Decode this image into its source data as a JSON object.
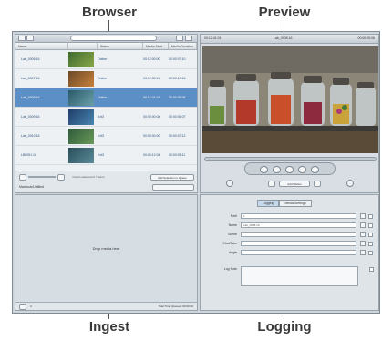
{
  "callouts": {
    "browser": "Browser",
    "preview": "Preview",
    "ingest": "Ingest",
    "logging": "Logging"
  },
  "browser": {
    "columns": [
      "Name",
      "",
      "Status",
      "Media Start",
      "Media Duration"
    ],
    "rows": [
      {
        "name": "Lab_0006.16",
        "status": "Online",
        "start": "00:12:00:00",
        "duration": "00:00:07:10",
        "selected": false,
        "thumb": "green"
      },
      {
        "name": "Lab_0007.16",
        "status": "Online",
        "start": "00:12:30:11",
        "duration": "00:00:10:16",
        "selected": false,
        "thumb": "orange"
      },
      {
        "name": "Lab_0008.16",
        "status": "Online",
        "start": "00:12:41:01",
        "duration": "00:00:05:06",
        "selected": true,
        "thumb": "teal"
      },
      {
        "name": "Lab_0009.16",
        "status": "Ext3",
        "start": "00:00:00:04",
        "duration": "00:00:06:07",
        "selected": false,
        "thumb": "blue"
      },
      {
        "name": "Lab_0010.16",
        "status": "Ext3",
        "start": "00:00:00:00",
        "duration": "00:00:07:12",
        "selected": false,
        "thumb": "green2"
      },
      {
        "name": "LB0051.16",
        "status": "Ext3",
        "start": "00:00:12:04",
        "duration": "00:00:05:11",
        "selected": false,
        "thumb": "teal2"
      }
    ],
    "footer_left": "Macbook/Untitled",
    "footer_mid": "4 items selected of 7 items",
    "footer_button": "Add Selection to Queue"
  },
  "ingest": {
    "drop_label": "Drop media here",
    "footer_left": "0",
    "footer_right": "Total Time Queued: 00:00:00"
  },
  "preview": {
    "left_tc": "00:12:41:01",
    "center_name": "Lab_0008.16",
    "right_tc": "00:00:05:06",
    "mark_label": "Add Marker"
  },
  "logging": {
    "tabs": [
      {
        "label": "Logging",
        "active": true
      },
      {
        "label": "Media Settings",
        "active": false
      }
    ],
    "fields": [
      {
        "label": "Reel",
        "value": "1"
      },
      {
        "label": "Name",
        "value": "Lab_0008.16"
      },
      {
        "label": "Scene",
        "value": ""
      },
      {
        "label": "Shot/Take",
        "value": ""
      },
      {
        "label": "Angle",
        "value": ""
      }
    ],
    "log_note_label": "Log Note"
  },
  "colors": {
    "selection": "#5c8fc6",
    "chrome": "#cfd6dc"
  }
}
